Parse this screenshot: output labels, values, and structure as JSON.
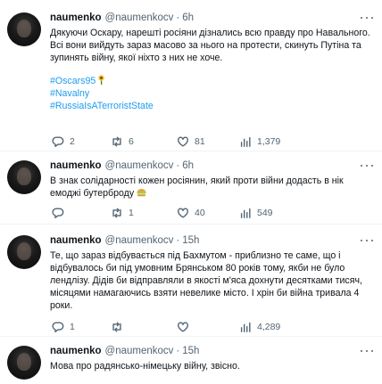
{
  "tweets": [
    {
      "name": "naumenko",
      "handle": "@naumenkocv",
      "sep": "·",
      "time": "6h",
      "text": "Дякуючи Оскару, нарешті росіяни дізнались всю правду про Навального.\nВсі вони вийдуть зараз масово за нього на протести, скинуть Путіна та\nзупинять війну, якої ніхто з них не хоче.",
      "hashtags": [
        "#Oscars95",
        "#Navalny",
        "#RussiaIsATerroristState"
      ],
      "replies": "2",
      "retweets": "6",
      "likes": "81",
      "views": "1,379"
    },
    {
      "name": "naumenko",
      "handle": "@naumenkocv",
      "sep": "·",
      "time": "6h",
      "text": "В знак солідарності кожен росіянин, який проти війни додасть в нік\nемоджі бутерброду",
      "replies": "",
      "retweets": "1",
      "likes": "40",
      "views": "549"
    },
    {
      "name": "naumenko",
      "handle": "@naumenkocv",
      "sep": "·",
      "time": "15h",
      "text": "Те, що зараз відбувається під Бахмутом - приблизно те саме, що і\nвідбувалось би під умовним Брянськом 80 років тому, якби не було\nленд­лізу. Дідів би відправляли в якості м'яса дохнути десятками тисяч,\nмісяцями намагаючись взяти невелике місто. І хрін би війна тривала 4\nроки.",
      "replies": "1",
      "retweets": "",
      "likes": "",
      "views": "4,289"
    },
    {
      "name": "naumenko",
      "handle": "@naumenkocv",
      "sep": "·",
      "time": "15h",
      "text": "Мова про радянсько-німецьку війну, звісно."
    }
  ],
  "icons": {
    "reply": "reply-icon",
    "retweet": "retweet-icon",
    "like": "heart-icon",
    "views": "views-icon",
    "more": "more-icon"
  },
  "colors": {
    "text": "#0f1419",
    "secondary": "#536471",
    "link": "#1d9bf0",
    "divider": "#eff3f4"
  }
}
